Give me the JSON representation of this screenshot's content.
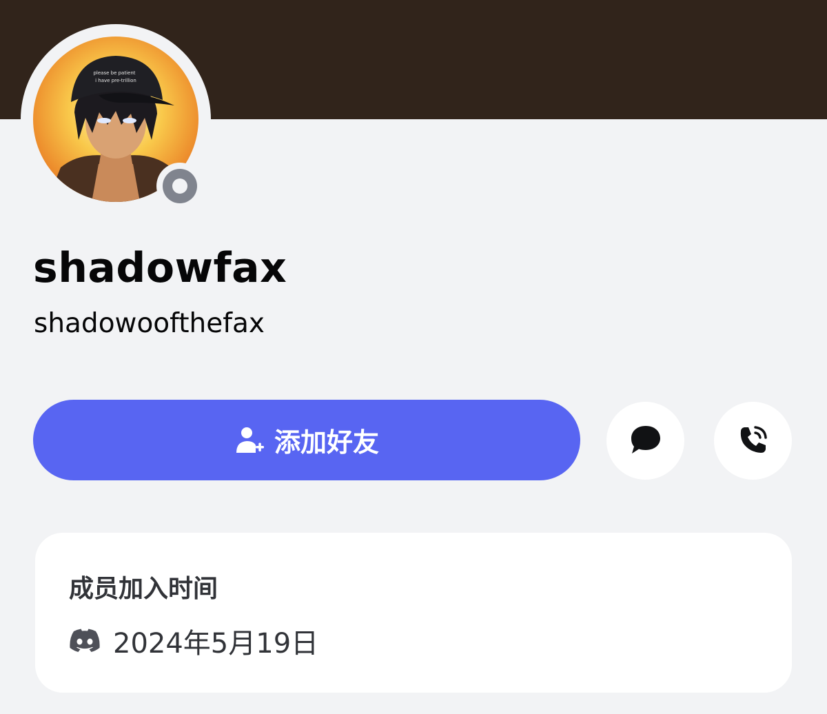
{
  "colors": {
    "banner": "#31241b",
    "background": "#f2f3f5",
    "accent": "#5865f2",
    "status_offline": "#80848e",
    "text_primary": "#060607",
    "text_secondary": "#313338",
    "card": "#ffffff"
  },
  "profile": {
    "display_name": "shadowfax",
    "username": "shadowoofthefax",
    "avatar_icon": "avatar-image",
    "avatar_hat_text_line1": "please be patient",
    "avatar_hat_text_line2": "i have pre-trillion",
    "status": "offline"
  },
  "actions": {
    "add_friend_label": "添加好友",
    "add_friend_icon": "add-friend-icon",
    "message_icon": "message-bubble-icon",
    "call_icon": "phone-call-icon"
  },
  "member_since": {
    "title": "成员加入时间",
    "icon": "discord-logo-icon",
    "date": "2024年5月19日"
  }
}
